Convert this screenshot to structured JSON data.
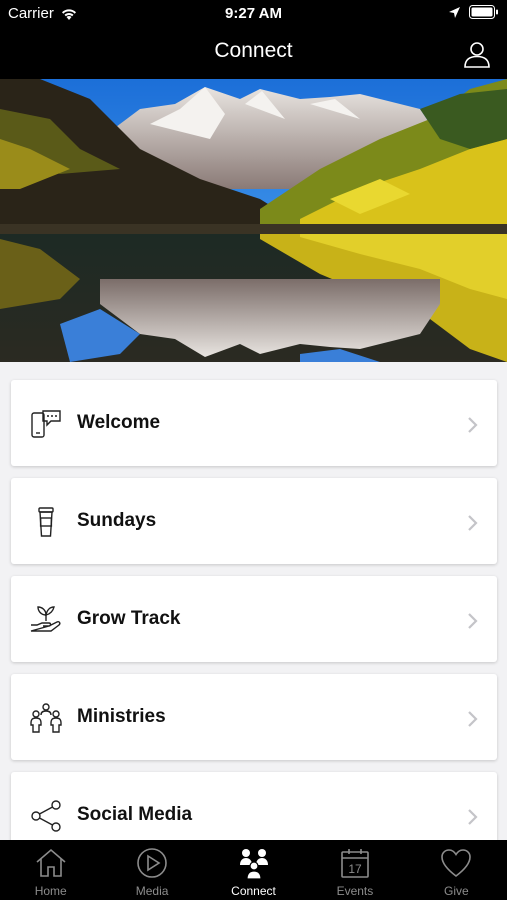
{
  "status_bar": {
    "carrier": "Carrier",
    "time": "9:27 AM"
  },
  "nav": {
    "title": "Connect"
  },
  "hero": {
    "description_icon": "mountain-lake-photo"
  },
  "list": {
    "items": [
      {
        "label": "Welcome",
        "icon": "phone-chat-icon"
      },
      {
        "label": "Sundays",
        "icon": "coffee-cup-icon"
      },
      {
        "label": "Grow Track",
        "icon": "hand-plant-icon"
      },
      {
        "label": "Ministries",
        "icon": "people-group-icon"
      },
      {
        "label": "Social Media",
        "icon": "share-icon"
      }
    ]
  },
  "tabs": [
    {
      "label": "Home",
      "icon": "home-icon",
      "active": false
    },
    {
      "label": "Media",
      "icon": "play-icon",
      "active": false
    },
    {
      "label": "Connect",
      "icon": "people-icon",
      "active": true
    },
    {
      "label": "Events",
      "icon": "calendar-icon",
      "active": false,
      "calendar_day": "17"
    },
    {
      "label": "Give",
      "icon": "heart-icon",
      "active": false
    }
  ],
  "colors": {
    "bar_background": "#000000",
    "page_background": "#f2f2f4",
    "tab_inactive": "#8c8c8c",
    "tab_active": "#ffffff"
  }
}
